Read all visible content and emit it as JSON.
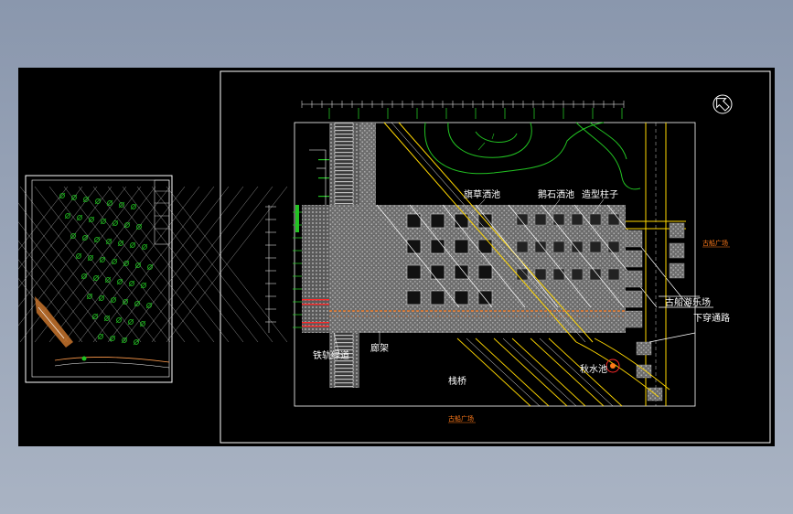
{
  "drawing": {
    "labels": {
      "tiecao_lvdao": "铁轨绿道",
      "tieqiao_bottom": "栈桥",
      "huali": "廊架",
      "shuicao_lihua": "旗草洒池",
      "yuanshi_lihua": "鹅石洒池",
      "zaoxing_zhuzi": "造型柱子",
      "gu_zhuo_yuleichang": "古船游乐场",
      "xia_chuan_tongdao": "下穿通路",
      "xiu_shu_chi": "秋水池",
      "guchuan_guangchang_right": "古船广场",
      "guchuan_guangchang_bottom": "古船广场"
    },
    "colors": {
      "sheet": "#000000",
      "frame": "#ffffff",
      "paving": "#8a8a8a",
      "road": "#ffd700",
      "contour": "#22c222",
      "accent": "#ff7a1a",
      "red": "#ff2a2a",
      "cyan": "#22d6e6"
    },
    "icons": {
      "north_arrow": "north-arrow-icon"
    }
  }
}
